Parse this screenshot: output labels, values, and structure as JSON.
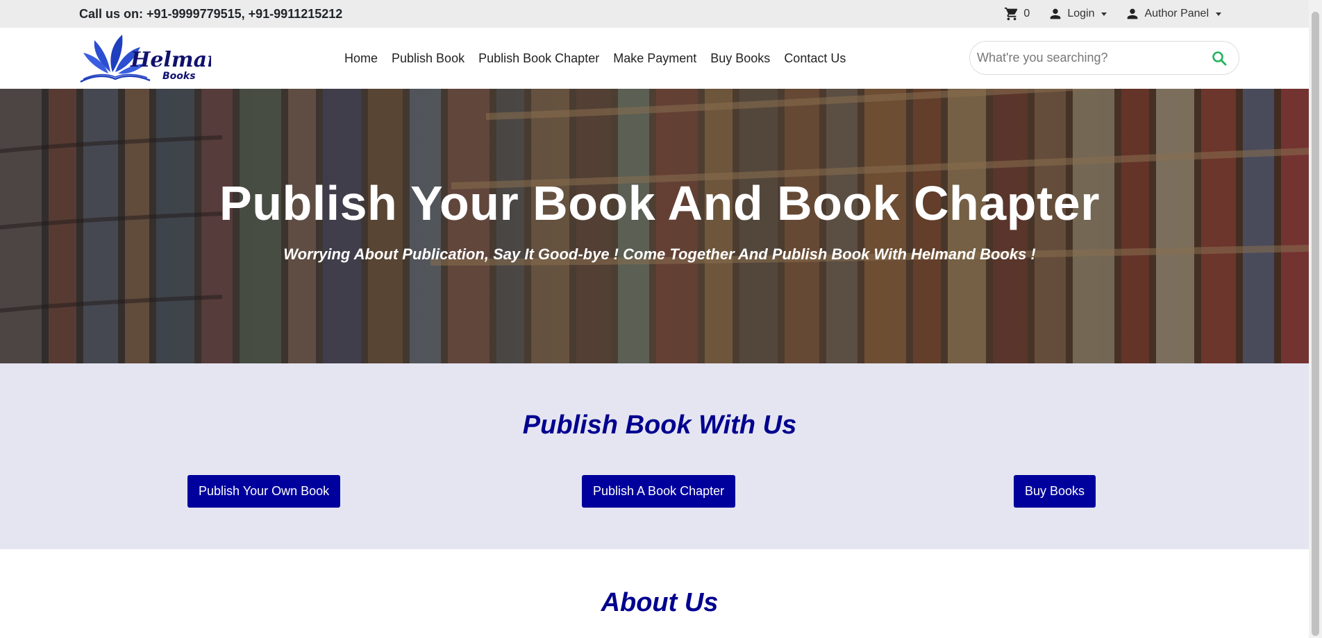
{
  "topbar": {
    "call_text": "Call us on: +91-9999779515, +91-9911215212",
    "cart_count": "0",
    "login_label": "Login",
    "author_panel_label": "Author Panel"
  },
  "nav": {
    "logo_alt": "Helmand Books",
    "links": [
      "Home",
      "Publish Book",
      "Publish Book Chapter",
      "Make Payment",
      "Buy Books",
      "Contact Us"
    ],
    "search_placeholder": "What're you searching?"
  },
  "hero": {
    "title": "Publish Your Book And Book Chapter",
    "subtitle": "Worrying About Publication, Say It Good-bye ! Come Together And Publish Book With Helmand Books !"
  },
  "publish": {
    "heading": "Publish Book With Us",
    "buttons": [
      "Publish Your Own Book",
      "Publish A Book Chapter",
      "Buy Books"
    ]
  },
  "about": {
    "heading": "About Us"
  },
  "colors": {
    "brand_blue": "#00009d",
    "heading_blue": "#00008f",
    "search_icon": "#22b35e",
    "section_bg": "#e5e5f1"
  },
  "icons": [
    "cart-icon",
    "user-icon",
    "search-icon",
    "logo"
  ]
}
